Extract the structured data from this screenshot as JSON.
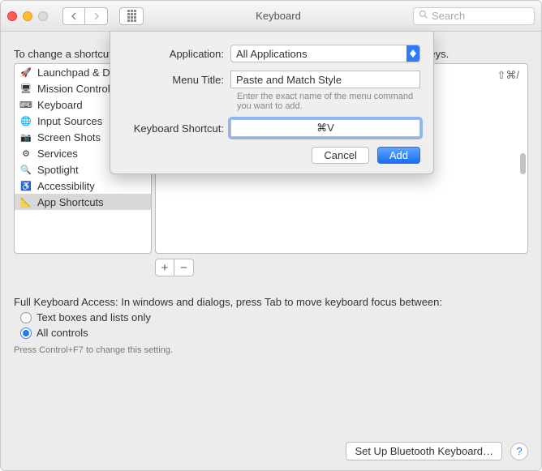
{
  "window": {
    "title": "Keyboard",
    "search_placeholder": "Search"
  },
  "leadtext": "To change a shortcut, select it, double-click the key combination, and then type the new keys.",
  "sidebar": {
    "items": [
      {
        "icon": "launchpad",
        "label": "Launchpad & Dock"
      },
      {
        "icon": "mission",
        "label": "Mission Control"
      },
      {
        "icon": "keyboard",
        "label": "Keyboard"
      },
      {
        "icon": "input",
        "label": "Input Sources"
      },
      {
        "icon": "screen",
        "label": "Screen Shots"
      },
      {
        "icon": "services",
        "label": "Services"
      },
      {
        "icon": "spotlight",
        "label": "Spotlight"
      },
      {
        "icon": "accessibility",
        "label": "Accessibility"
      },
      {
        "icon": "appshortcuts",
        "label": "App Shortcuts"
      }
    ]
  },
  "detail_hint": "⇧⌘/",
  "plus": "+",
  "minus": "−",
  "fka": {
    "intro": "Full Keyboard Access: In windows and dialogs, press Tab to move keyboard focus between:",
    "opt1": "Text boxes and lists only",
    "opt2": "All controls",
    "tip": "Press Control+F7 to change this setting."
  },
  "footer": {
    "bt_button": "Set Up Bluetooth Keyboard…",
    "help": "?"
  },
  "sheet": {
    "app_label": "Application:",
    "app_value": "All Applications",
    "menu_label": "Menu Title:",
    "menu_value": "Paste and Match Style",
    "menu_hint": "Enter the exact name of the menu command you want to add.",
    "shortcut_label": "Keyboard Shortcut:",
    "shortcut_value": "⌘V",
    "cancel": "Cancel",
    "add": "Add"
  }
}
